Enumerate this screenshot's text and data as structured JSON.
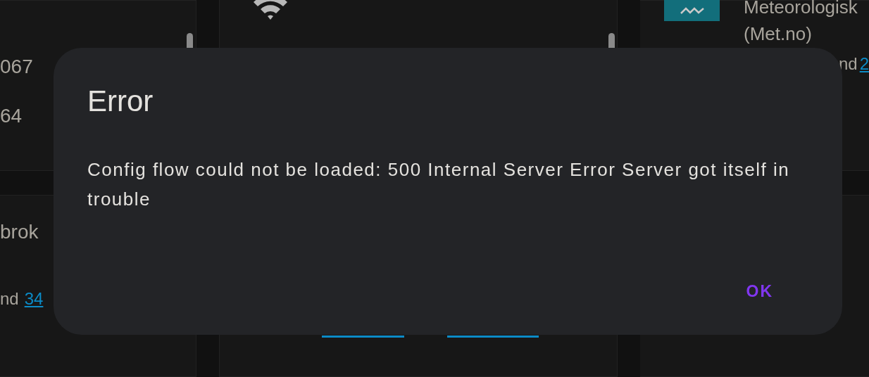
{
  "background": {
    "left_cards": [
      {
        "lines": [
          {
            "text": "067"
          },
          {
            "text": "64"
          }
        ]
      },
      {
        "lines": [
          {
            "text": "brok"
          },
          {
            "text": "nd",
            "link": "34"
          }
        ]
      }
    ],
    "right_card": {
      "title_lines": [
        "Meteorologisk",
        "(Met.no)"
      ],
      "line": {
        "text": "nd",
        "link": "2"
      }
    }
  },
  "dialog": {
    "title": "Error",
    "message": "Config flow could not be loaded: 500 Internal Server Error Server got itself in trouble",
    "buttons": [
      "OK"
    ]
  }
}
